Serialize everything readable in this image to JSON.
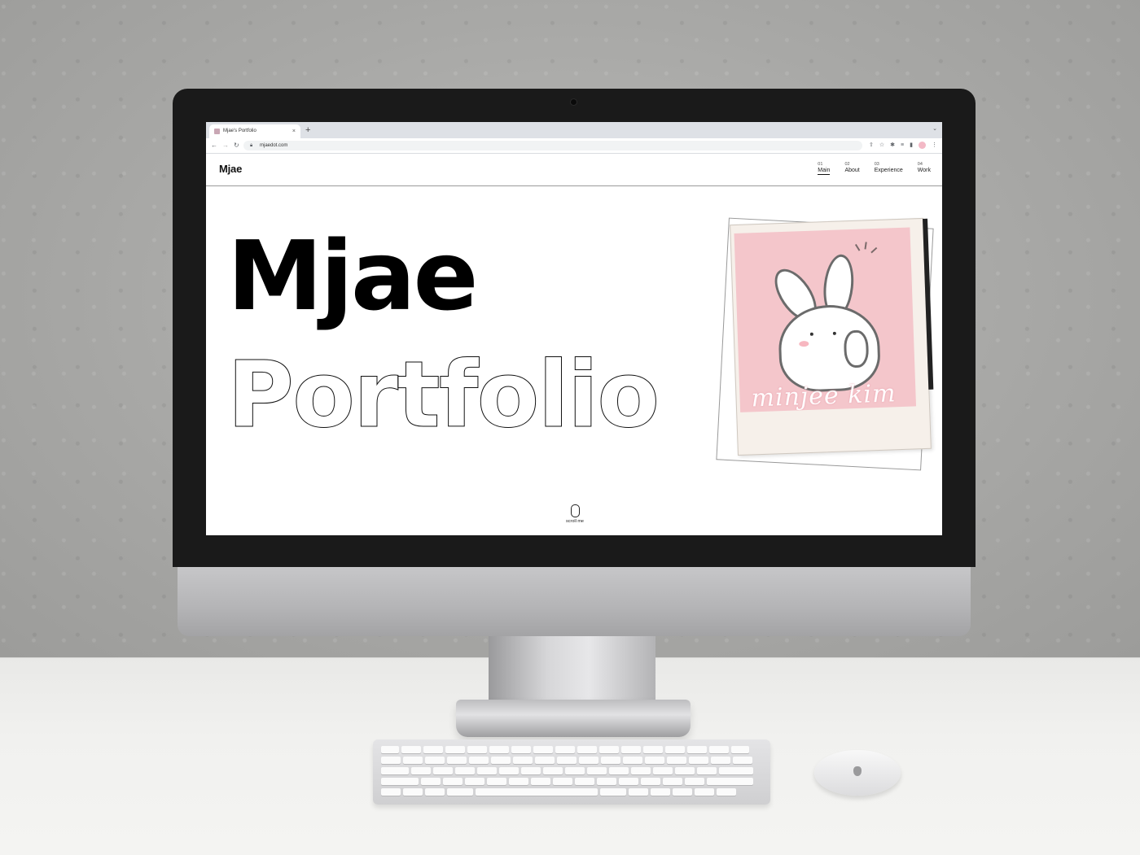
{
  "browser": {
    "tab_title": "Mjae's Portfolio",
    "tab_close": "×",
    "new_tab": "+",
    "url": "mjaedot.com"
  },
  "site": {
    "logo": "Mjae",
    "nav": [
      {
        "num": "01",
        "label": "Main",
        "active": true
      },
      {
        "num": "02",
        "label": "About",
        "active": false
      },
      {
        "num": "03",
        "label": "Experience",
        "active": false
      },
      {
        "num": "04",
        "label": "Work",
        "active": false
      }
    ],
    "hero_title": "Mjae",
    "hero_subtitle": "Portfolio",
    "signature": "minjee kim",
    "scroll_label": "scroll me"
  },
  "colors": {
    "photo_background": "#f4c6cb",
    "accent_text": "#000000"
  }
}
